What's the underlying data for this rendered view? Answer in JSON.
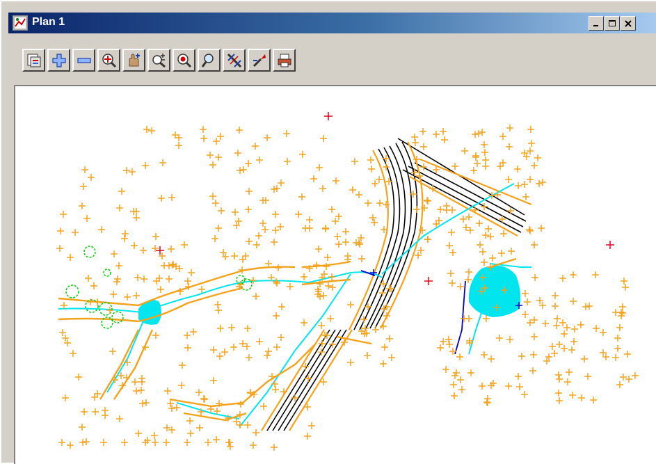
{
  "window": {
    "title": "Plan 1"
  },
  "colors": {
    "titlebar_start": "#0a246a",
    "titlebar_end": "#a6caf0",
    "points": "#f5a21b",
    "water": "#00e5ee",
    "road": "#000000",
    "markers": "#e0001b",
    "circles": "#00cc00",
    "line_blue": "#0000cc"
  },
  "caption_buttons": [
    {
      "name": "minimize-button",
      "icon": "minimize-icon"
    },
    {
      "name": "maximize-button",
      "icon": "maximize-icon"
    },
    {
      "name": "close-button",
      "icon": "close-icon"
    }
  ],
  "toolbar": {
    "buttons": [
      {
        "name": "layers-button",
        "icon": "layers-icon"
      },
      {
        "name": "zoom-in-button",
        "icon": "plus-icon"
      },
      {
        "name": "zoom-out-button",
        "icon": "minus-icon"
      },
      {
        "name": "zoom-fit-button",
        "icon": "zoom-fit-icon"
      },
      {
        "name": "pan-button",
        "icon": "pan-hand-icon"
      },
      {
        "name": "zoom-plus-minus-button",
        "icon": "zoom-plus-minus-icon"
      },
      {
        "name": "zoom-extent-button",
        "icon": "zoom-extent-icon"
      },
      {
        "name": "zoom-window-button",
        "icon": "magnifier-icon"
      },
      {
        "name": "cross-section-button",
        "icon": "cross-section-icon"
      },
      {
        "name": "pick-tool-button",
        "icon": "pick-tool-icon"
      },
      {
        "name": "print-button",
        "icon": "printer-icon"
      }
    ]
  }
}
